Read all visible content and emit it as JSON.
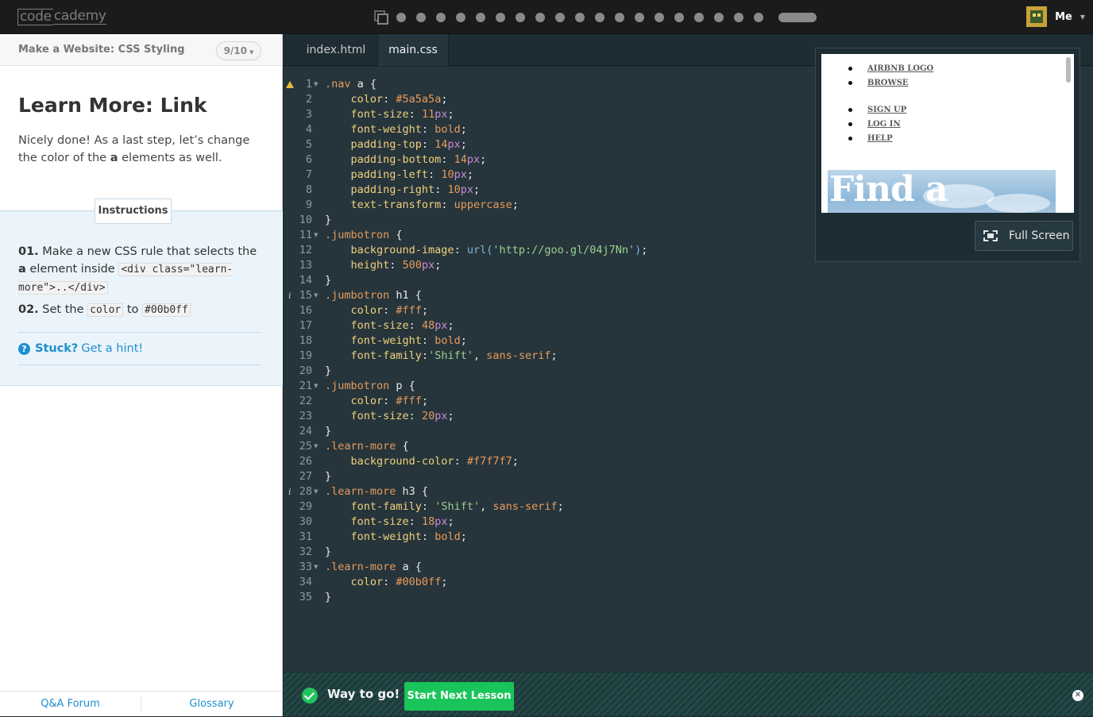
{
  "header": {
    "logo_code": "code",
    "logo_academy": "cademy",
    "user_name": "Me"
  },
  "progress": {
    "dots": 19,
    "current_bar": true
  },
  "sidebar": {
    "lesson_title": "Make a Website: CSS Styling",
    "lesson_count": "9/10",
    "heading": "Learn More: Link",
    "intro_before": "Nicely done! As a last step, let’s change the color of the ",
    "intro_bold": "a",
    "intro_after": " elements as well.",
    "instructions_tab": "Instructions",
    "step1_num": "01.",
    "step1_text": " Make a new CSS rule that selects the ",
    "step1_bold": "a",
    "step1_text2": " element inside ",
    "step1_code": "<div class=\"learn-more\">..</div>",
    "step2_num": "02.",
    "step2_text": " Set the ",
    "step2_code1": "color",
    "step2_text2": " to ",
    "step2_code2": "#00b0ff",
    "stuck_label": "Stuck?",
    "hint_label": "Get a hint!",
    "footer_forum": "Q&A Forum",
    "footer_glossary": "Glossary"
  },
  "editor": {
    "tabs": [
      "index.html",
      "main.css"
    ],
    "active_tab": "main.css",
    "warning_lines": [
      1
    ],
    "info_lines": [
      15,
      28
    ],
    "lines": [
      [
        [
          "sel",
          ".nav"
        ],
        [
          "brace",
          " a {"
        ]
      ],
      [
        [
          "brace",
          "    "
        ],
        [
          "prop",
          "color"
        ],
        [
          "brace",
          ": "
        ],
        [
          "val",
          "#5a5a5a"
        ],
        [
          "brace",
          ";"
        ]
      ],
      [
        [
          "brace",
          "    "
        ],
        [
          "prop",
          "font-size"
        ],
        [
          "brace",
          ": "
        ],
        [
          "num",
          "11"
        ],
        [
          "unit",
          "px"
        ],
        [
          "brace",
          ";"
        ]
      ],
      [
        [
          "brace",
          "    "
        ],
        [
          "prop",
          "font-weight"
        ],
        [
          "brace",
          ": "
        ],
        [
          "val",
          "bold"
        ],
        [
          "brace",
          ";"
        ]
      ],
      [
        [
          "brace",
          "    "
        ],
        [
          "prop",
          "padding-top"
        ],
        [
          "brace",
          ": "
        ],
        [
          "num",
          "14"
        ],
        [
          "unit",
          "px"
        ],
        [
          "brace",
          ";"
        ]
      ],
      [
        [
          "brace",
          "    "
        ],
        [
          "prop",
          "padding-bottom"
        ],
        [
          "brace",
          ": "
        ],
        [
          "num",
          "14"
        ],
        [
          "unit",
          "px"
        ],
        [
          "brace",
          ";"
        ]
      ],
      [
        [
          "brace",
          "    "
        ],
        [
          "prop",
          "padding-left"
        ],
        [
          "brace",
          ": "
        ],
        [
          "num",
          "10"
        ],
        [
          "unit",
          "px"
        ],
        [
          "brace",
          ";"
        ]
      ],
      [
        [
          "brace",
          "    "
        ],
        [
          "prop",
          "padding-right"
        ],
        [
          "brace",
          ": "
        ],
        [
          "num",
          "10"
        ],
        [
          "unit",
          "px"
        ],
        [
          "brace",
          ";"
        ]
      ],
      [
        [
          "brace",
          "    "
        ],
        [
          "prop",
          "text-transform"
        ],
        [
          "brace",
          ": "
        ],
        [
          "val",
          "uppercase"
        ],
        [
          "brace",
          ";"
        ]
      ],
      [
        [
          "brace",
          "}"
        ]
      ],
      [
        [
          "sel",
          ".jumbotron"
        ],
        [
          "brace",
          " {"
        ]
      ],
      [
        [
          "brace",
          "    "
        ],
        [
          "prop",
          "background-image"
        ],
        [
          "brace",
          ": "
        ],
        [
          "fn",
          "url("
        ],
        [
          "str",
          "'http://goo.gl/04j7Nn'"
        ],
        [
          "fn",
          ")"
        ],
        [
          "brace",
          ";"
        ]
      ],
      [
        [
          "brace",
          "    "
        ],
        [
          "prop",
          "height"
        ],
        [
          "brace",
          ": "
        ],
        [
          "num",
          "500"
        ],
        [
          "unit",
          "px"
        ],
        [
          "brace",
          ";"
        ]
      ],
      [
        [
          "brace",
          "}"
        ]
      ],
      [
        [
          "sel",
          ".jumbotron"
        ],
        [
          "brace",
          " h1 {"
        ]
      ],
      [
        [
          "brace",
          "    "
        ],
        [
          "prop",
          "color"
        ],
        [
          "brace",
          ": "
        ],
        [
          "val",
          "#fff"
        ],
        [
          "brace",
          ";"
        ]
      ],
      [
        [
          "brace",
          "    "
        ],
        [
          "prop",
          "font-size"
        ],
        [
          "brace",
          ": "
        ],
        [
          "num",
          "48"
        ],
        [
          "unit",
          "px"
        ],
        [
          "brace",
          ";"
        ]
      ],
      [
        [
          "brace",
          "    "
        ],
        [
          "prop",
          "font-weight"
        ],
        [
          "brace",
          ": "
        ],
        [
          "val",
          "bold"
        ],
        [
          "brace",
          ";"
        ]
      ],
      [
        [
          "brace",
          "    "
        ],
        [
          "prop",
          "font-family"
        ],
        [
          "brace",
          ":"
        ],
        [
          "str",
          "'Shift'"
        ],
        [
          "brace",
          ", "
        ],
        [
          "val",
          "sans-serif"
        ],
        [
          "brace",
          ";"
        ]
      ],
      [
        [
          "brace",
          "}"
        ]
      ],
      [
        [
          "sel",
          ".jumbotron"
        ],
        [
          "brace",
          " p {"
        ]
      ],
      [
        [
          "brace",
          "    "
        ],
        [
          "prop",
          "color"
        ],
        [
          "brace",
          ": "
        ],
        [
          "val",
          "#fff"
        ],
        [
          "brace",
          ";"
        ]
      ],
      [
        [
          "brace",
          "    "
        ],
        [
          "prop",
          "font-size"
        ],
        [
          "brace",
          ": "
        ],
        [
          "num",
          "20"
        ],
        [
          "unit",
          "px"
        ],
        [
          "brace",
          ";"
        ]
      ],
      [
        [
          "brace",
          "}"
        ]
      ],
      [
        [
          "sel",
          ".learn-more"
        ],
        [
          "brace",
          " {"
        ]
      ],
      [
        [
          "brace",
          "    "
        ],
        [
          "prop",
          "background-color"
        ],
        [
          "brace",
          ": "
        ],
        [
          "val",
          "#f7f7f7"
        ],
        [
          "brace",
          ";"
        ]
      ],
      [
        [
          "brace",
          "}"
        ]
      ],
      [
        [
          "sel",
          ".learn-more"
        ],
        [
          "brace",
          " h3 {"
        ]
      ],
      [
        [
          "brace",
          "    "
        ],
        [
          "prop",
          "font-family"
        ],
        [
          "brace",
          ": "
        ],
        [
          "str",
          "'Shift'"
        ],
        [
          "brace",
          ", "
        ],
        [
          "val",
          "sans-serif"
        ],
        [
          "brace",
          ";"
        ]
      ],
      [
        [
          "brace",
          "    "
        ],
        [
          "prop",
          "font-size"
        ],
        [
          "brace",
          ": "
        ],
        [
          "num",
          "18"
        ],
        [
          "unit",
          "px"
        ],
        [
          "brace",
          ";"
        ]
      ],
      [
        [
          "brace",
          "    "
        ],
        [
          "prop",
          "font-weight"
        ],
        [
          "brace",
          ": "
        ],
        [
          "val",
          "bold"
        ],
        [
          "brace",
          ";"
        ]
      ],
      [
        [
          "brace",
          "}"
        ]
      ],
      [
        [
          "sel",
          ".learn-more"
        ],
        [
          "brace",
          " a {"
        ]
      ],
      [
        [
          "brace",
          "    "
        ],
        [
          "prop",
          "color"
        ],
        [
          "brace",
          ": "
        ],
        [
          "val",
          "#00b0ff"
        ],
        [
          "brace",
          ";"
        ]
      ],
      [
        [
          "brace",
          "}"
        ]
      ]
    ]
  },
  "preview": {
    "nav_group1": [
      "AIRBNB LOGO",
      "BROWSE"
    ],
    "nav_group2": [
      "SIGN UP",
      "LOG IN",
      "HELP"
    ],
    "jumbotron_text": "Find a",
    "fullscreen_label": "Full Screen"
  },
  "bottom": {
    "message": "Way to go!",
    "next_button": "Start Next Lesson"
  }
}
